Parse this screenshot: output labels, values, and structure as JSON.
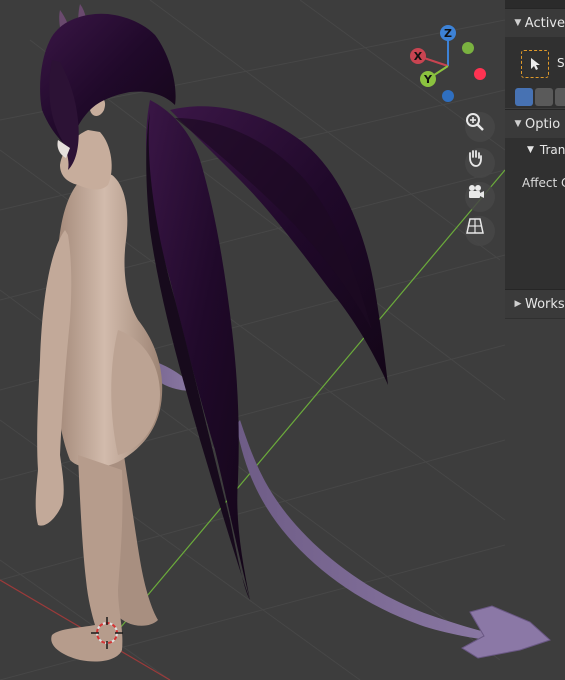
{
  "gizmo": {
    "x_label": "X",
    "y_label": "Y",
    "z_label": "Z",
    "colors": {
      "x": "#c84451",
      "y": "#8bc23f",
      "z": "#3d82d6",
      "neg_x": "#ff3352",
      "neg_y": "#7ab240",
      "neg_z": "#2f6fc0"
    }
  },
  "nav_tools": {
    "zoom_icon": "zoom-icon",
    "pan_icon": "hand-icon",
    "camera_icon": "camera-icon",
    "ortho_icon": "grid-icon"
  },
  "sidebar": {
    "active_tool_header": "Active",
    "active_tool_name": "S",
    "options_header": "Optio",
    "transform_subheader": "Tran",
    "affect_label": "Affect C",
    "workspace_header": "Works"
  },
  "scene": {
    "character": "horned character with long purple ponytail and tail",
    "colors": {
      "skin": "#c6ad9d",
      "hair": "#2a0f33",
      "tail": "#7e6b94",
      "grid": "#4a4a4a",
      "axis_green": "#6bab3b",
      "axis_red": "#9b3a3a"
    }
  }
}
